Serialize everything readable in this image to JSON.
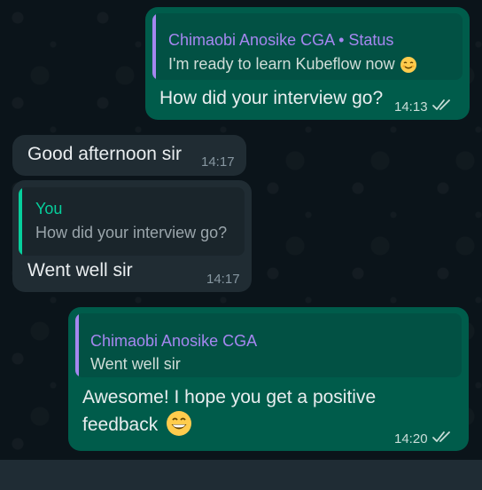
{
  "colors": {
    "outgoing_bubble": "#005c4b",
    "incoming_bubble": "#202c33",
    "quote_accent_purple": "#a587f0",
    "quote_accent_green": "#06cf9c",
    "read_ticks": "#c9ddd8"
  },
  "messages": [
    {
      "direction": "outgoing",
      "quote": {
        "author": "Chimaobi Anosike CGA • Status",
        "text": "I'm ready to learn Kubeflow now",
        "emoji_icon": "smiling-face-icon"
      },
      "text": "How did your interview go?",
      "time": "14:13",
      "status_icon": "double-check-icon"
    },
    {
      "direction": "incoming",
      "text": "Good afternoon sir",
      "time": "14:17"
    },
    {
      "direction": "incoming",
      "quote": {
        "author": "You",
        "text": "How did your interview go?"
      },
      "text": "Went well sir",
      "time": "14:17"
    },
    {
      "direction": "outgoing",
      "quote": {
        "author": "Chimaobi Anosike CGA",
        "text": "Went well sir"
      },
      "text_line1": "Awesome! I hope you get a positive",
      "text_line2": "feedback",
      "emoji_icon": "grinning-face-icon",
      "time": "14:20",
      "status_icon": "double-check-icon"
    }
  ]
}
